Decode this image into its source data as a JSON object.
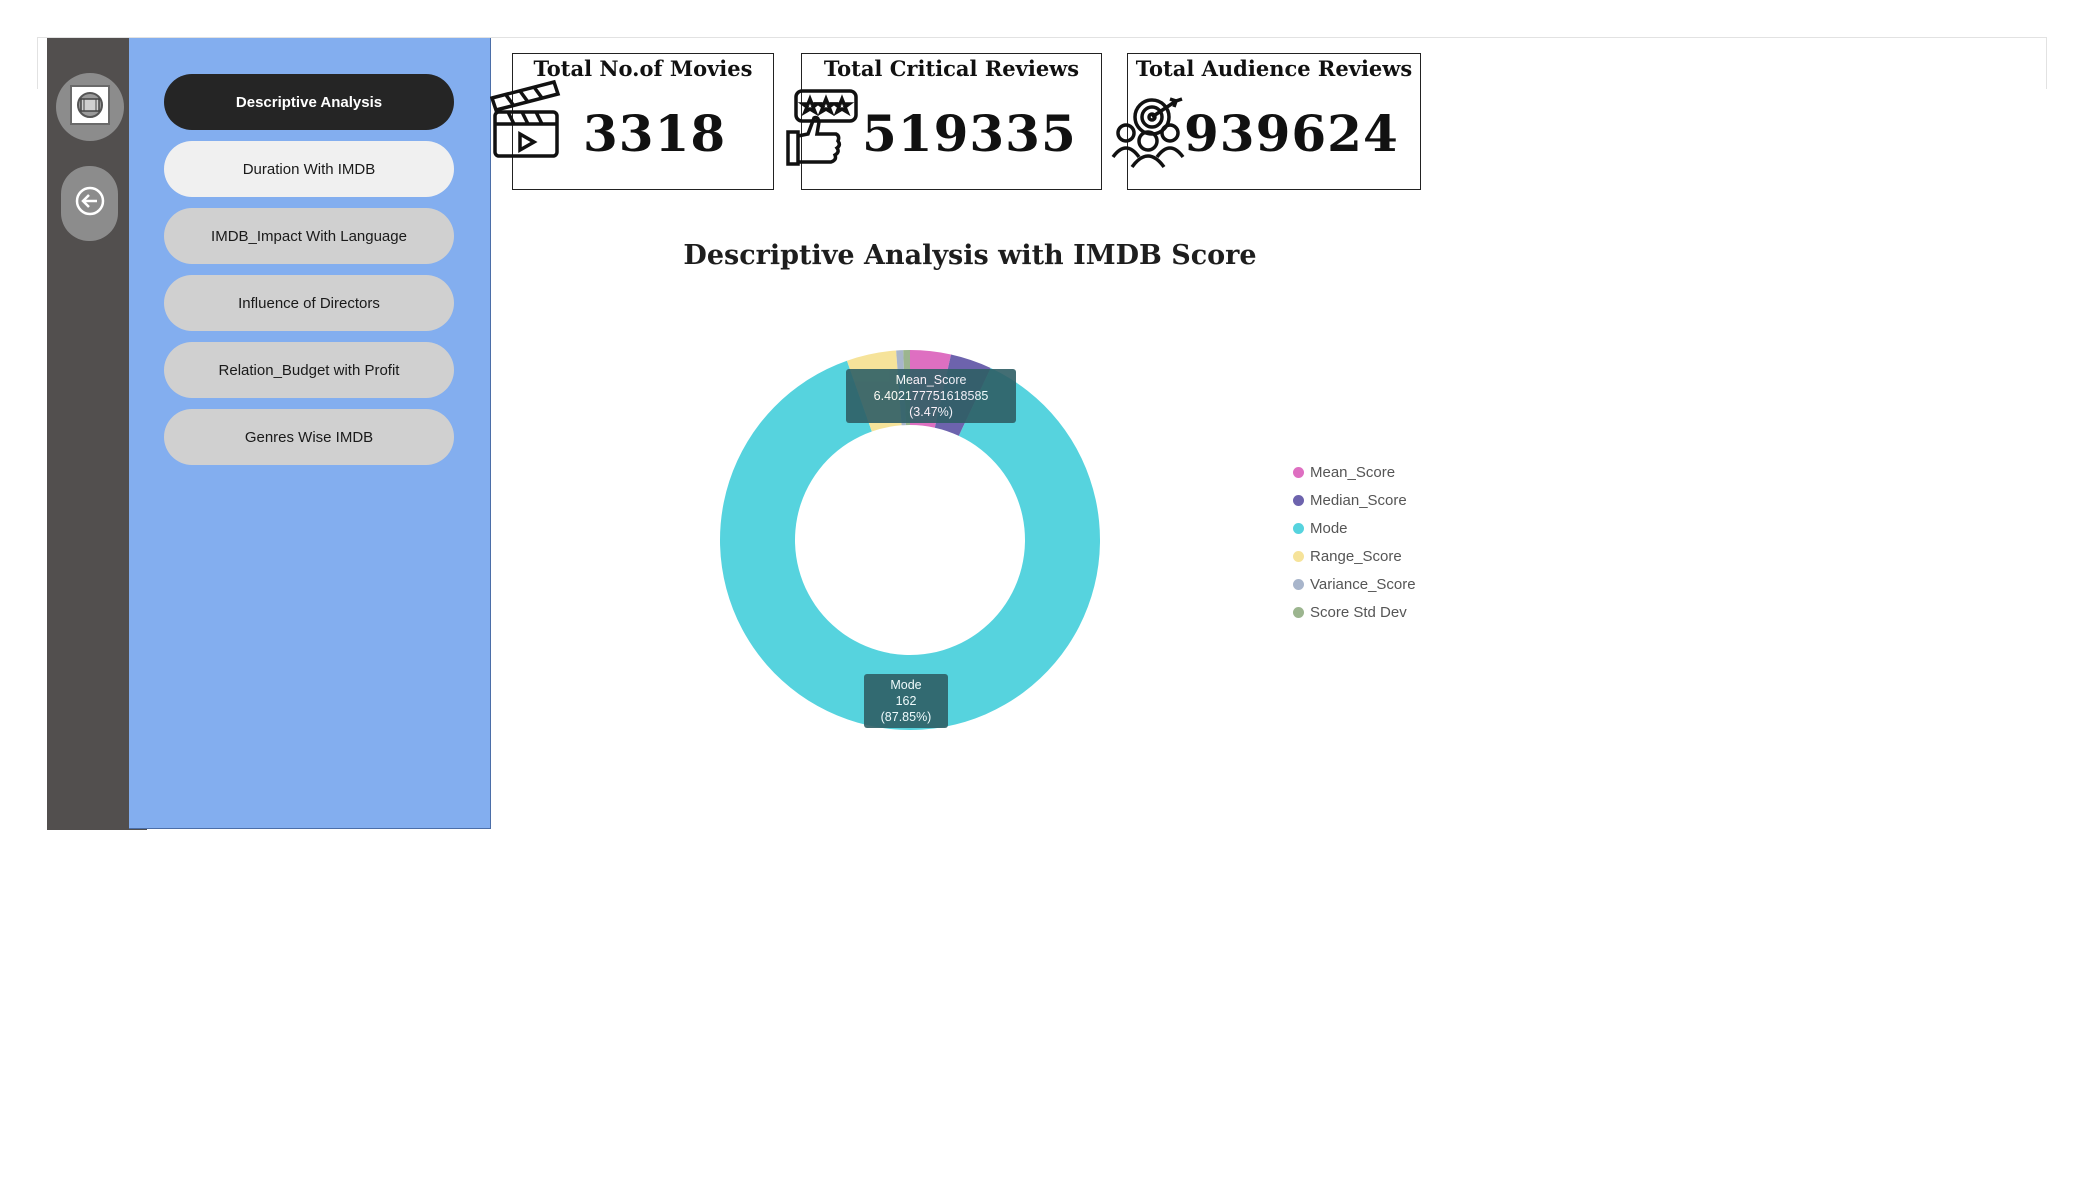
{
  "nav": {
    "items": [
      {
        "label": "Descriptive Analysis",
        "state": "active"
      },
      {
        "label": "Duration With IMDB",
        "state": "hover"
      },
      {
        "label": "IMDB_Impact With Language",
        "state": "normal"
      },
      {
        "label": "Influence of Directors",
        "state": "normal"
      },
      {
        "label": "Relation_Budget with Profit",
        "state": "normal"
      },
      {
        "label": "Genres Wise IMDB",
        "state": "normal"
      }
    ],
    "rail_icons": [
      "film-reel-icon",
      "back-arrow-icon"
    ]
  },
  "kpis": [
    {
      "title": "Total No.of Movies",
      "value": "3318",
      "icon": "clapperboard-icon"
    },
    {
      "title": "Total Critical Reviews",
      "value": "519335",
      "icon": "thumbs-up-review-icon"
    },
    {
      "title": "Total Audience Reviews",
      "value": "939624",
      "icon": "audience-target-icon"
    }
  ],
  "colors": {
    "rail": "#524f4e",
    "nav_panel": "#83aeef",
    "nav_active": "#252525",
    "tooltip": "#2f5f66"
  },
  "chart_data": {
    "type": "pie",
    "variant": "donut",
    "title": "Descriptive Analysis with IMDB Score",
    "legend_position": "right",
    "series": [
      {
        "name": "Mean_Score",
        "value": 6.402177751618585,
        "percent": 3.47,
        "color": "#de6fc1"
      },
      {
        "name": "Median_Score",
        "value": 6.5,
        "percent": 3.53,
        "color": "#6d63ad"
      },
      {
        "name": "Mode",
        "value": 162,
        "percent": 87.85,
        "color": "#56d3de"
      },
      {
        "name": "Range_Score",
        "value": 7.8,
        "percent": 4.23,
        "color": "#f6e39a"
      },
      {
        "name": "Variance_Score",
        "value": 1.1,
        "percent": 0.6,
        "color": "#a8b5cb"
      },
      {
        "name": "Score Std Dev",
        "value": 1.05,
        "percent": 0.57,
        "color": "#9cb58f"
      }
    ],
    "tooltips": [
      {
        "line1": "Mean_Score",
        "line2": "6.402177751618585 (3.47%)"
      },
      {
        "line1": "Mode",
        "line2": "162 (87.85%)"
      }
    ]
  }
}
